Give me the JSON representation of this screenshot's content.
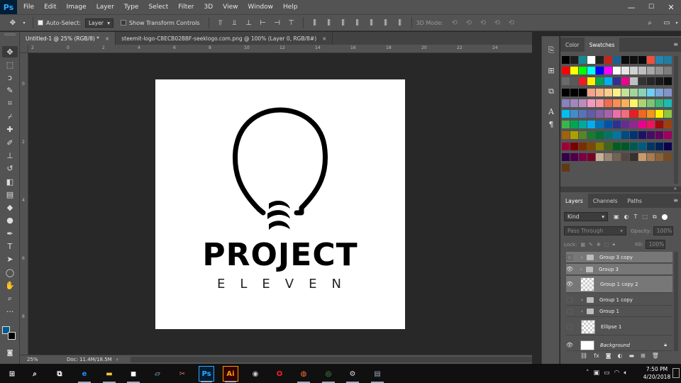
{
  "app": {
    "logo": "Ps",
    "accent": "#31a8ff"
  },
  "menu": [
    "File",
    "Edit",
    "Image",
    "Layer",
    "Type",
    "Select",
    "Filter",
    "3D",
    "View",
    "Window",
    "Help"
  ],
  "window_controls": {
    "minimize": "—",
    "maximize": "☐",
    "close": "✕"
  },
  "options": {
    "auto_select_label": "Auto-Select:",
    "auto_select_value": "Layer",
    "show_transform_label": "Show Transform Controls",
    "mode_3d_label": "3D Mode:"
  },
  "tabs": [
    {
      "label": "Untitled-1 @ 25% (RGB/8) *",
      "close": "×"
    },
    {
      "label": "steemit-logo-C8ECB02BBF-seeklogo.com.png @ 100% (Layer 0, RGB/8#)",
      "close": "×"
    }
  ],
  "ruler_top": [
    "2",
    "0",
    "2",
    "4",
    "6",
    "8",
    "10",
    "12",
    "14",
    "16",
    "18",
    "20",
    "22",
    "24"
  ],
  "ruler_left": [
    "0",
    "2",
    "4",
    "6",
    "8",
    "10"
  ],
  "artwork": {
    "line1": "PROJECT",
    "line2": "ELEVEN"
  },
  "status": {
    "zoom": "25%",
    "doc_info": "Doc: 11.4M/18.5M",
    "arrow": "›"
  },
  "swatch_panel": {
    "tabs": [
      "Color",
      "Swatches"
    ],
    "active_tab": "Swatches",
    "colors": [
      "#000000",
      "#1d1d1d",
      "#138b96",
      "#ffffff",
      "#221f1f",
      "#c0261d",
      "#1a6190",
      "#0b0b0b",
      "#101010",
      "#0a0a0a",
      "#ef4f3b",
      "#2385b2",
      "#1d7ea2",
      "#ff0000",
      "#ffff00",
      "#00ff00",
      "#00ffff",
      "#0000ff",
      "#ff00ff",
      "#ffffff",
      "#e6e6e6",
      "#d1d1d1",
      "#bfbfbf",
      "#a8a8a8",
      "#939393",
      "#7d7d7d",
      "#6a6a6a",
      "#595959",
      "#ed1c24",
      "#fff200",
      "#00a651",
      "#00aeef",
      "#2e3192",
      "#ec008c",
      "#c0c0c0",
      "#333333",
      "#262626",
      "#1a1a1a",
      "#0d0d0d",
      "#000000",
      "#000000",
      "#000000",
      "#f5a28e",
      "#f7b78c",
      "#fbcc8a",
      "#fef08a",
      "#c5e29a",
      "#a4d49c",
      "#8cd1b4",
      "#6dcff6",
      "#7da7d9",
      "#8493ca",
      "#8882be",
      "#a187be",
      "#bc8cbf",
      "#f49ac2",
      "#f6989d",
      "#f26c4f",
      "#f68e55",
      "#fbaf5d",
      "#fff568",
      "#acd373",
      "#7cc576",
      "#3bb878",
      "#1abbb4",
      "#00bff3",
      "#438cca",
      "#5574b9",
      "#605ca8",
      "#855fa8",
      "#a763a8",
      "#f06eaa",
      "#f26d7d",
      "#ed1c24",
      "#f26522",
      "#f7941d",
      "#fff200",
      "#8dc73f",
      "#39b54a",
      "#00a651",
      "#00a99d",
      "#00aeef",
      "#0072bc",
      "#0054a6",
      "#2e3192",
      "#662d91",
      "#92278f",
      "#ec008c",
      "#ed145b",
      "#9e0b0f",
      "#a0410d",
      "#a36209",
      "#aba000",
      "#598527",
      "#1a7b30",
      "#007236",
      "#00746b",
      "#0076a3",
      "#004b80",
      "#003471",
      "#1b1464",
      "#440e62",
      "#630460",
      "#9e005d",
      "#9e0039",
      "#790000",
      "#7b2e00",
      "#7d4900",
      "#827b00",
      "#406618",
      "#005e20",
      "#005826",
      "#005952",
      "#005b7f",
      "#003663",
      "#002157",
      "#0d004c",
      "#32004b",
      "#4b0049",
      "#7b0046",
      "#7a0026",
      "#c7b299",
      "#998675",
      "#736357",
      "#534741",
      "#37302d",
      "#c69c6d",
      "#a67c52",
      "#8c6239",
      "#754c24",
      "#603913"
    ]
  },
  "layers_panel": {
    "tabs": [
      "Layers",
      "Channels",
      "Paths"
    ],
    "active_tab": "Layers",
    "filter": "Kind",
    "blend_mode": "Pass Through",
    "opacity_label": "Opacity:",
    "opacity_value": "100%",
    "lock_label": "Lock:",
    "fill_label": "Fill:",
    "fill_value": "100%",
    "layers": [
      {
        "name": "Group 3 copy",
        "type": "group",
        "visible": false,
        "selected": true
      },
      {
        "name": "Group 3",
        "type": "group",
        "visible": true,
        "selected": true
      },
      {
        "name": "Group 1 copy 2",
        "type": "smart",
        "visible": true,
        "selected": true
      },
      {
        "name": "Group 1 copy",
        "type": "group",
        "visible": false,
        "selected": false
      },
      {
        "name": "Group 1",
        "type": "group",
        "visible": false,
        "selected": false
      },
      {
        "name": "Ellipse 1",
        "type": "smart",
        "visible": false,
        "selected": false
      },
      {
        "name": "Background",
        "type": "background",
        "visible": true,
        "selected": false
      }
    ]
  },
  "taskbar": {
    "apps": [
      "Windows",
      "Search",
      "Task View",
      "Edge",
      "File Explorer",
      "Store",
      "Notepad",
      "Snipping",
      "Photoshop",
      "Illustrator",
      "OBS",
      "Opera",
      "Firefox",
      "Chrome",
      "Settings",
      "Network"
    ],
    "time": "7:50 PM",
    "date": "4/20/2018"
  }
}
